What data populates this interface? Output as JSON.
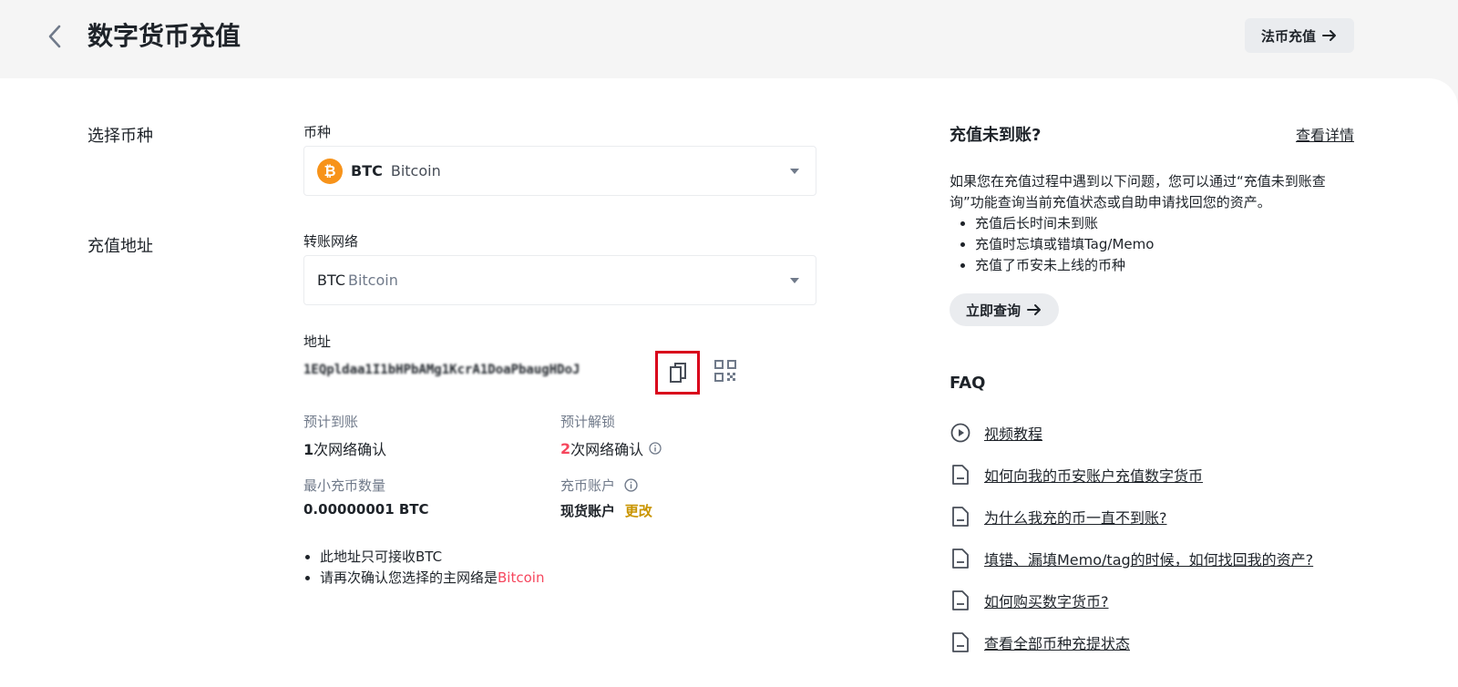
{
  "header": {
    "title": "数字货币充值",
    "fiat_button": "法币充值"
  },
  "form": {
    "select_coin_label": "选择币种",
    "coin_field_label": "币种",
    "coin": {
      "symbol": "BTC",
      "name": "Bitcoin"
    },
    "deposit_address_label": "充值地址",
    "network_field_label": "转账网络",
    "network": {
      "symbol": "BTC",
      "name": "Bitcoin"
    },
    "address_label": "地址",
    "address_value": "1EQpldaa1I1bHPbAMg1KcrA1DoaPbaugHDoJ",
    "expected_arrival_label": "预计到账",
    "expected_arrival_count": "1",
    "expected_arrival_text": "次网络确认",
    "expected_unlock_label": "预计解锁",
    "expected_unlock_count": "2",
    "expected_unlock_text": "次网络确认",
    "min_deposit_label": "最小充币数量",
    "min_deposit_value": "0.00000001 BTC",
    "deposit_account_label": "充币账户",
    "deposit_account_value": "现货账户",
    "change_link": "更改",
    "notes": [
      "此地址只可接收BTC",
      "请再次确认您选择的主网络是"
    ],
    "note_network_highlight": "Bitcoin"
  },
  "sidebar": {
    "title": "充值未到账?",
    "details_link": "查看详情",
    "description": "如果您在充值过程中遇到以下问题，您可以通过“充值未到账查询”功能查询当前充值状态或自助申请找回您的资产。",
    "issues": [
      "充值后长时间未到账",
      "充值时忘填或错填Tag/Memo",
      "充值了币安未上线的币种"
    ],
    "query_button": "立即查询",
    "faq_title": "FAQ",
    "faq_items": [
      {
        "label": "视频教程",
        "icon": "play-circle-icon"
      },
      {
        "label": "如何向我的币安账户充值数字货币",
        "icon": "document-icon"
      },
      {
        "label": "为什么我充的币一直不到账?",
        "icon": "document-icon"
      },
      {
        "label": "填错、漏填Memo/tag的时候，如何找回我的资产?",
        "icon": "document-icon"
      },
      {
        "label": "如何购买数字货币?",
        "icon": "document-icon"
      },
      {
        "label": "查看全部币种充提状态",
        "icon": "document-icon"
      }
    ]
  },
  "colors": {
    "brand_gold": "#c99400",
    "red": "#f6465d",
    "btc_orange": "#f7931a",
    "highlight_box": "#d9001b"
  }
}
